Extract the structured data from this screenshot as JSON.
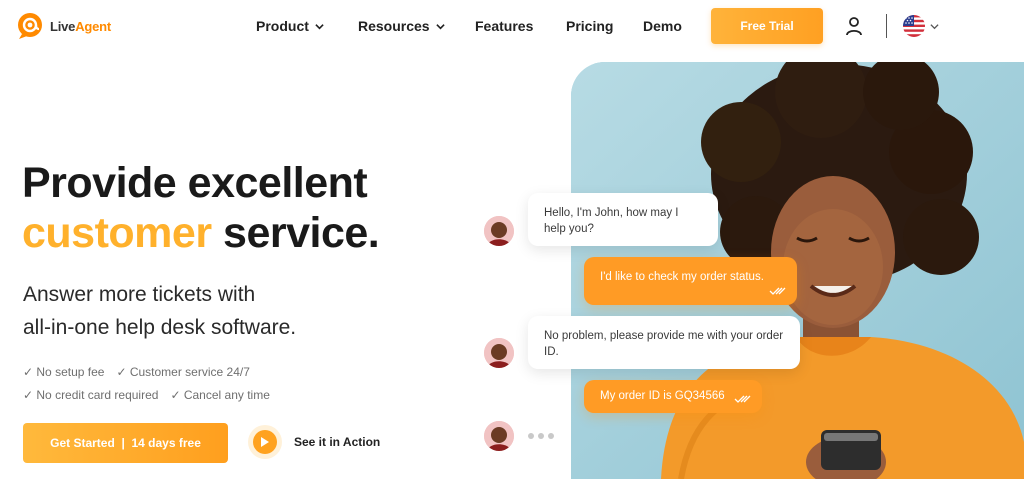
{
  "nav": {
    "logo_text_a": "Live",
    "logo_text_b": "Agent",
    "items": [
      {
        "label": "Product"
      },
      {
        "label": "Resources"
      },
      {
        "label": "Features"
      },
      {
        "label": "Pricing"
      },
      {
        "label": "Demo"
      }
    ],
    "trial_label": "Free Trial",
    "language": "us-flag-icon"
  },
  "hero": {
    "line1": "Provide excellent",
    "line2_accent": "customer",
    "line2_rest": " service.",
    "sub1": "Answer more tickets with",
    "sub2": "all-in-one help desk software.",
    "checks": [
      "✓ No setup fee",
      "✓ Customer service 24/7",
      "✓ No credit card required",
      "✓ Cancel any time"
    ],
    "cta_label": "Get Started  |  14 days free",
    "see_label": "See it in Action"
  },
  "chat": {
    "messages": [
      {
        "from": "agent",
        "text": "Hello, I'm John, how may I help you?"
      },
      {
        "from": "user",
        "text": "I'd like to check my order status."
      },
      {
        "from": "agent",
        "text": "No problem, please provide me with your order ID."
      },
      {
        "from": "user",
        "text": "My order ID is GQ34566"
      }
    ]
  },
  "colors": {
    "accent": "#ffb12c",
    "button": "#ffa022",
    "photo_bg": "#a9d3de"
  }
}
